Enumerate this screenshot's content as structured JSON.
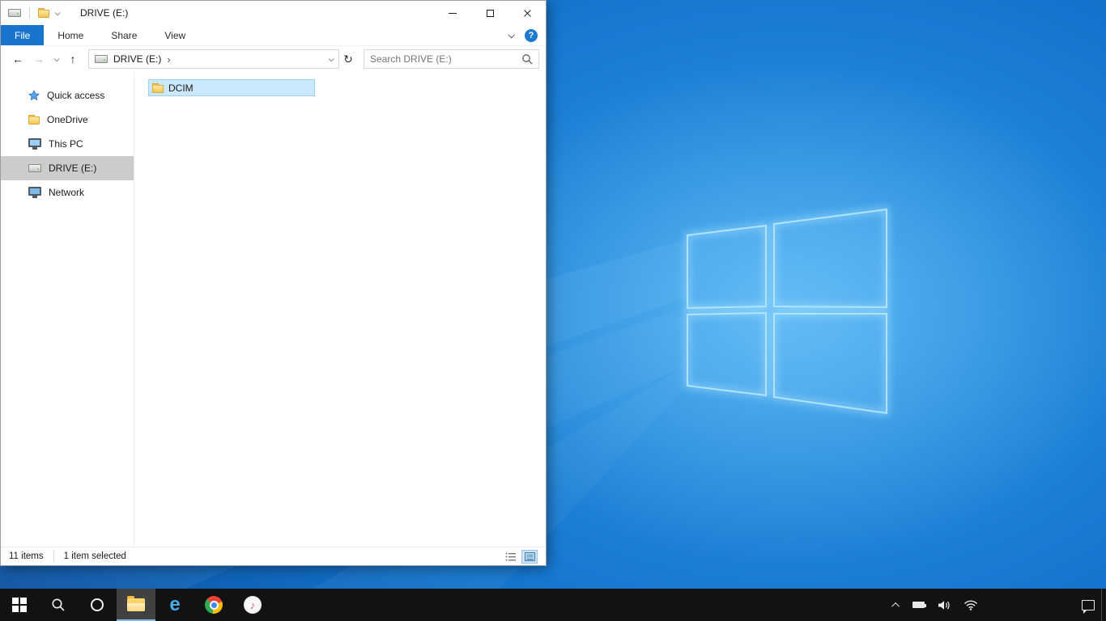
{
  "wallpaper": {
    "base_color": "#0b52a3",
    "logo_color": "#9edbff"
  },
  "window": {
    "titlebar": {
      "title": "DRIVE (E:)"
    },
    "ribbon": {
      "tabs": [
        {
          "label": "File",
          "active": true
        },
        {
          "label": "Home",
          "active": false
        },
        {
          "label": "Share",
          "active": false
        },
        {
          "label": "View",
          "active": false
        }
      ],
      "help_glyph": "?"
    },
    "nav": {
      "back_glyph": "←",
      "forward_glyph": "→",
      "up_glyph": "↑",
      "refresh_glyph": "↻"
    },
    "address": {
      "path_root": "DRIVE (E:)",
      "separator": "›"
    },
    "search": {
      "placeholder": "Search DRIVE (E:)"
    },
    "sidebar": {
      "items": [
        {
          "label": "Quick access",
          "icon": "star-icon",
          "selected": false
        },
        {
          "label": "OneDrive",
          "icon": "onedrive-folder-icon",
          "selected": false
        },
        {
          "label": "This PC",
          "icon": "monitor-icon",
          "selected": false
        },
        {
          "label": "DRIVE (E:)",
          "icon": "drive-icon",
          "selected": true
        },
        {
          "label": "Network",
          "icon": "network-icon",
          "selected": false
        }
      ]
    },
    "content": {
      "items": [
        {
          "name": "DCIM",
          "type": "folder",
          "selected": true
        }
      ]
    },
    "status": {
      "count": "11 items",
      "selected": "1 item selected"
    }
  },
  "taskbar": {
    "ie_glyph": "e",
    "itunes_glyph": "♪",
    "buttons": [
      "start",
      "search",
      "cortana",
      "file-explorer",
      "internet-explorer",
      "chrome",
      "itunes"
    ],
    "tray": [
      "show-hidden-icons",
      "battery",
      "volume",
      "network",
      "action-center"
    ]
  }
}
